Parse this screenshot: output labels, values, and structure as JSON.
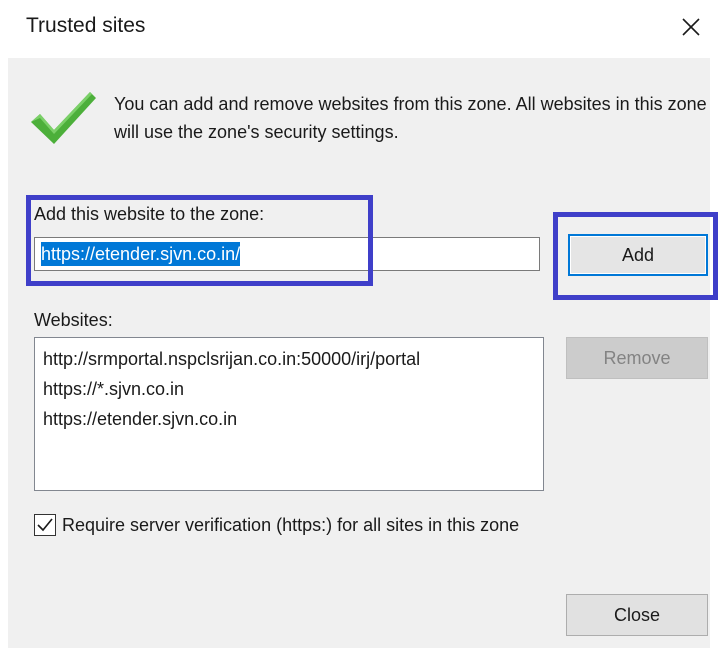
{
  "window": {
    "title": "Trusted sites",
    "close_icon": "close-icon"
  },
  "info": {
    "icon": "checkmark-icon",
    "text": "You can add and remove websites from this zone. All websites in this zone will use the zone's security settings."
  },
  "add_section": {
    "label": "Add this website to the zone:",
    "input_value": "https://etender.sjvn.co.in/",
    "add_button": "Add"
  },
  "websites": {
    "label": "Websites:",
    "items": [
      "http://srmportal.nspclsrijan.co.in:50000/irj/portal",
      "https://*.sjvn.co.in",
      "https://etender.sjvn.co.in"
    ],
    "remove_button": "Remove"
  },
  "verification": {
    "checked": true,
    "label": "Require server verification (https:) for all sites in this zone"
  },
  "footer": {
    "close_button": "Close"
  },
  "colors": {
    "accent": "#0078d7",
    "highlight_box": "#3f3fc9",
    "check_green": "#4caf3a",
    "dialog_bg": "#f0f0f0"
  }
}
